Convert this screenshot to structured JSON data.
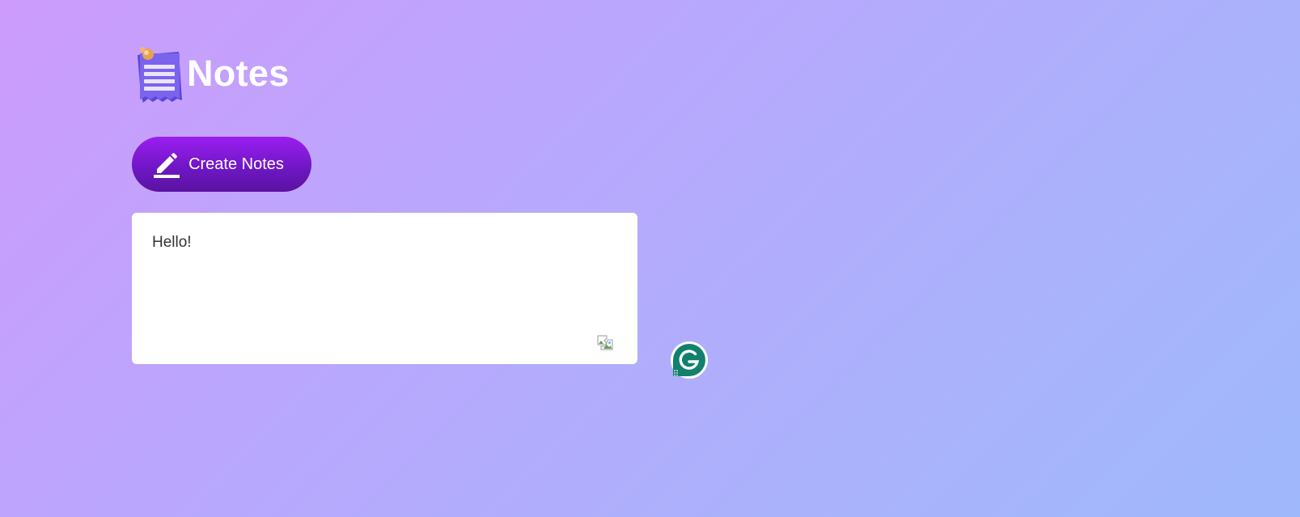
{
  "header": {
    "title": "Notes",
    "icon": "notepad-icon"
  },
  "toolbar": {
    "create_label": "Create Notes",
    "create_icon": "pencil-icon",
    "accent_color": "#7a18d4"
  },
  "notes": [
    {
      "text": "Hello!",
      "delete_icon": "broken-image-icon"
    }
  ],
  "extensions": {
    "grammarly_icon": "grammarly-icon",
    "grammarly_color": "#12806e"
  }
}
